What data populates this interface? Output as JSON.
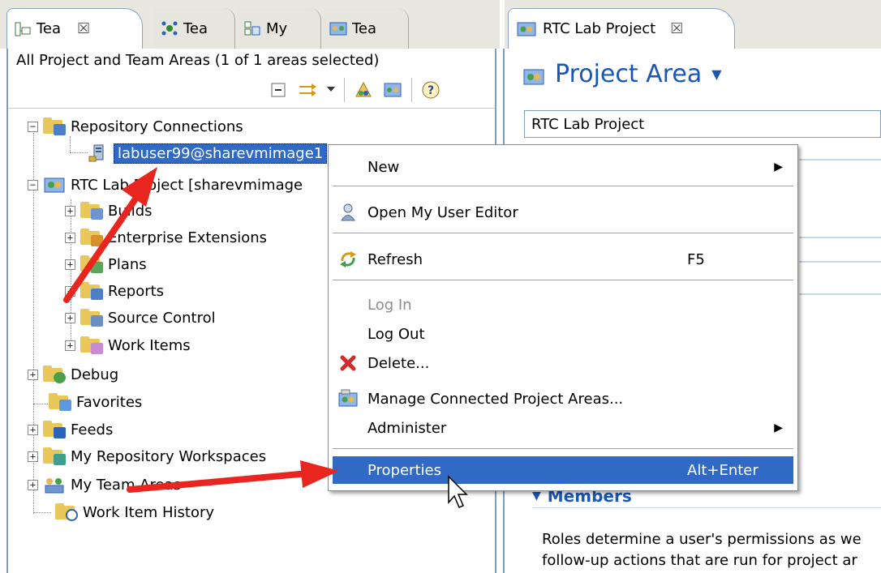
{
  "left_view": {
    "tabs": [
      {
        "label": "Tea",
        "active": true
      },
      {
        "label": "Tea",
        "active": false
      },
      {
        "label": "My",
        "active": false
      },
      {
        "label": "Tea",
        "active": false
      }
    ],
    "close_glyph": "☒",
    "area_summary": "All Project and Team Areas (1 of 1 areas selected)",
    "toolbar_icons": [
      "collapse-all-icon",
      "sync-with-editor-icon",
      "view-menu-icon",
      "project-area-icon",
      "team-area-icon",
      "help-icon"
    ],
    "tree": {
      "repository_connections": "Repository Connections",
      "connection": "labuser99@sharevmimage1",
      "project": "RTC Lab Project [sharevmimage",
      "project_children": [
        "Builds",
        "Enterprise Extensions",
        "Plans",
        "Reports",
        "Source Control",
        "Work Items"
      ],
      "debug": "Debug",
      "favorites": "Favorites",
      "feeds": "Feeds",
      "my_repository_workspaces": "My Repository Workspaces",
      "my_team_areas": "My Team Areas",
      "work_item_history": "Work Item History"
    }
  },
  "editor": {
    "tab_label": "RTC Lab Project",
    "title": "Project Area",
    "project_name_value": "RTC Lab Project",
    "members_heading": "Members",
    "description_lines": [
      "Roles determine a user's permissions as we",
      "follow-up actions that are run for project ar"
    ]
  },
  "context_menu": {
    "items": [
      {
        "label": "New",
        "submenu": true
      },
      {
        "label": "Open My User Editor"
      },
      {
        "label": "Refresh",
        "accelerator": "F5"
      },
      {
        "label": "Log In",
        "disabled": true
      },
      {
        "label": "Log Out"
      },
      {
        "label": "Delete..."
      },
      {
        "label": "Manage Connected Project Areas..."
      },
      {
        "label": "Administer",
        "submenu": true
      },
      {
        "label": "Properties",
        "accelerator": "Alt+Enter",
        "highlighted": true
      }
    ]
  },
  "colors": {
    "selection": "#316ac5",
    "title_blue": "#1a57b5",
    "annotation_arrow": "#e8251e",
    "folder": "#e9c75a"
  }
}
